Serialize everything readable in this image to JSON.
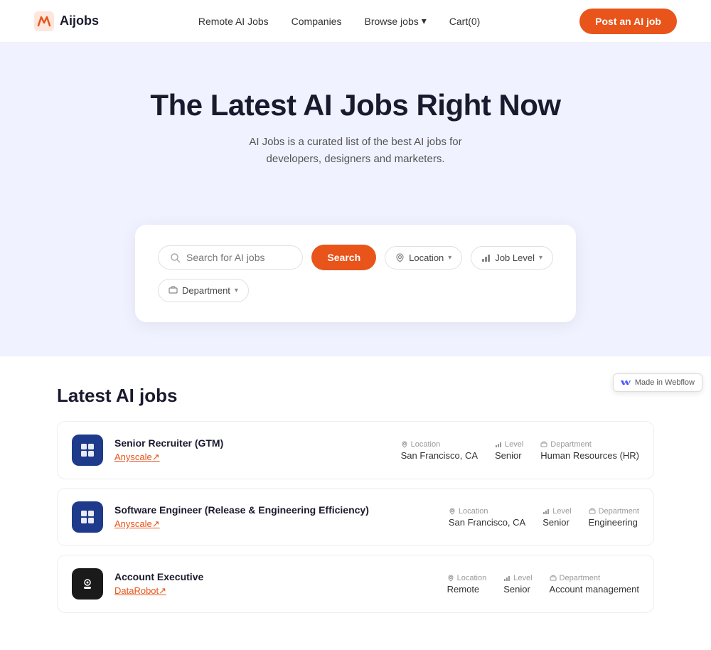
{
  "nav": {
    "logo_text": "Aijobs",
    "links": [
      {
        "label": "Remote AI Jobs",
        "id": "remote-ai-jobs"
      },
      {
        "label": "Companies",
        "id": "companies"
      },
      {
        "label": "Browse jobs",
        "id": "browse-jobs"
      }
    ],
    "cart_label": "Cart(0)",
    "cta_label": "Post an AI job"
  },
  "hero": {
    "heading": "The Latest AI Jobs Right Now",
    "subtext": "AI Jobs is a curated list of the best AI jobs for developers, designers and marketers."
  },
  "search": {
    "input_placeholder": "Search for AI jobs",
    "search_btn_label": "Search",
    "filters": [
      {
        "label": "Location",
        "icon": "location-icon",
        "id": "location-filter"
      },
      {
        "label": "Job Level",
        "icon": "level-icon",
        "id": "level-filter"
      },
      {
        "label": "Department",
        "icon": "department-icon",
        "id": "department-filter"
      }
    ]
  },
  "jobs_section": {
    "heading": "Latest AI jobs",
    "jobs": [
      {
        "id": "job-1",
        "title": "Senior Recruiter (GTM)",
        "company": "Anyscale",
        "company_link_suffix": "↗",
        "location_label": "Location",
        "location_value": "San Francisco, CA",
        "level_label": "Level",
        "level_value": "Senior",
        "department_label": "Department",
        "department_value": "Human Resources (HR)",
        "logo_type": "anyscale"
      },
      {
        "id": "job-2",
        "title": "Software Engineer (Release & Engineering Efficiency)",
        "company": "Anyscale",
        "company_link_suffix": "↗",
        "location_label": "Location",
        "location_value": "San Francisco, CA",
        "level_label": "Level",
        "level_value": "Senior",
        "department_label": "Department",
        "department_value": "Engineering",
        "logo_type": "anyscale"
      },
      {
        "id": "job-3",
        "title": "Account Executive",
        "company": "DataRobot",
        "company_link_suffix": "↗",
        "location_label": "Location",
        "location_value": "Remote",
        "level_label": "Level",
        "level_value": "Senior",
        "department_label": "Department",
        "department_value": "Account management",
        "logo_type": "datarobot"
      }
    ]
  },
  "webflow_badge": {
    "label": "Made in Webflow"
  }
}
